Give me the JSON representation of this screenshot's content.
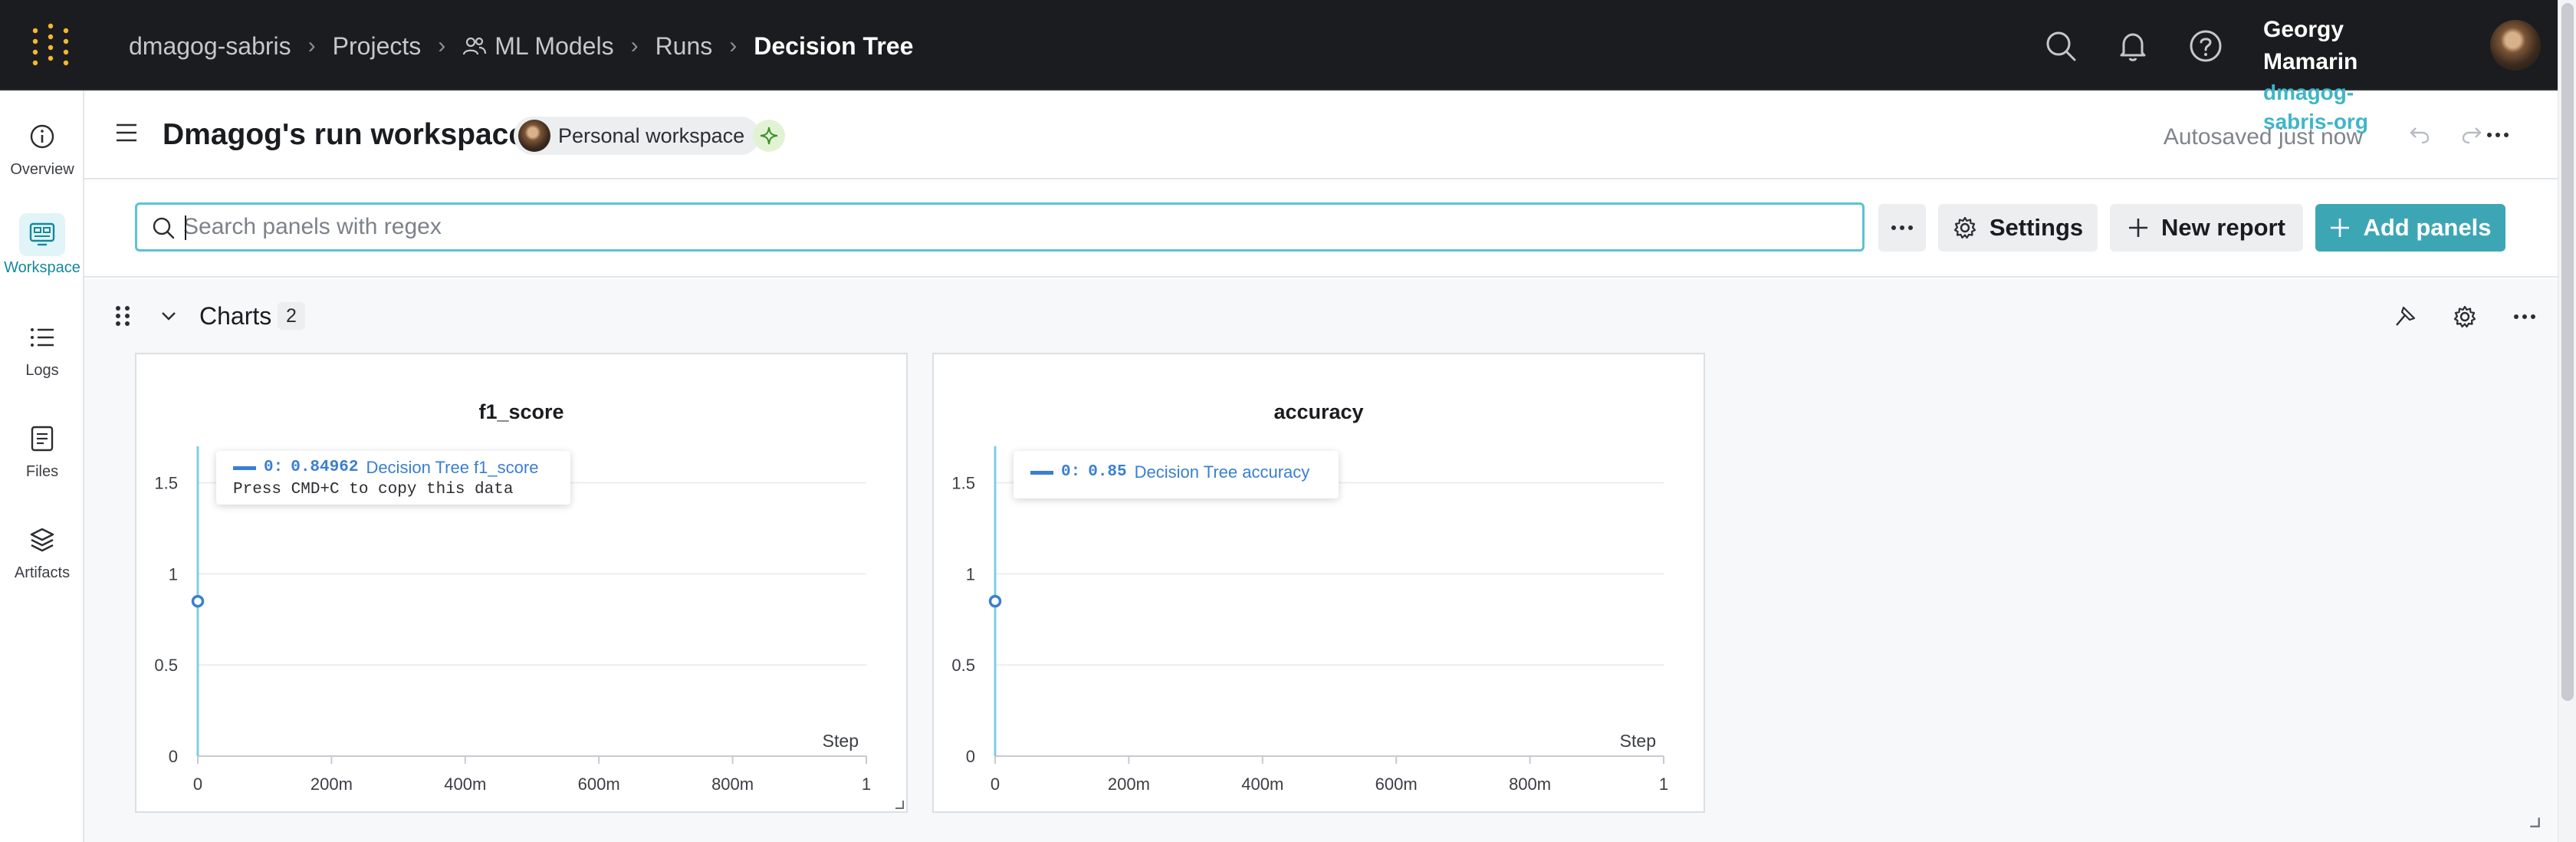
{
  "topbar": {
    "breadcrumbs": [
      {
        "label": "dmagog-sabris",
        "icon": null
      },
      {
        "label": "Projects",
        "icon": null
      },
      {
        "label": "ML Models",
        "icon": "users-icon"
      },
      {
        "label": "Runs",
        "icon": null
      },
      {
        "label": "Decision Tree",
        "icon": null
      }
    ],
    "user": {
      "name": "Georgy Mamarin",
      "org": "dmagog-sabris-org"
    }
  },
  "sidebar": {
    "items": [
      {
        "label": "Overview",
        "icon": "info-icon",
        "active": false
      },
      {
        "label": "Workspace",
        "icon": "workspace-icon",
        "active": true
      },
      {
        "label": "Logs",
        "icon": "list-icon",
        "active": false
      },
      {
        "label": "Files",
        "icon": "file-icon",
        "active": false
      },
      {
        "label": "Artifacts",
        "icon": "layers-icon",
        "active": false
      }
    ]
  },
  "workspace": {
    "title": "Dmagog's run workspace",
    "badge": "Personal workspace",
    "autosaved": "Autosaved just now"
  },
  "toolbar": {
    "search_placeholder": "Search panels with regex",
    "settings_label": "Settings",
    "new_report_label": "New report",
    "add_panels_label": "Add panels"
  },
  "section": {
    "title": "Charts",
    "count": "2"
  },
  "panels": [
    {
      "title": "f1_score",
      "tooltip": {
        "index": "0:",
        "value": "0.84962",
        "series": "Decision Tree f1_score",
        "hint": "Press CMD+C to copy this data"
      }
    },
    {
      "title": "accuracy",
      "tooltip": {
        "index": "0:",
        "value": "0.85",
        "series": "Decision Tree accuracy",
        "hint": ""
      }
    }
  ],
  "colors": {
    "accent": "#3da6b5",
    "series": "#3a7fcf",
    "topbar": "#1a1c1f"
  },
  "chart_data": [
    {
      "type": "line",
      "title": "f1_score",
      "xlabel": "Step",
      "ylabel": "",
      "x_ticks": [
        "0",
        "200m",
        "400m",
        "600m",
        "800m",
        "1"
      ],
      "y_ticks": [
        "0",
        "0.5",
        "1",
        "1.5"
      ],
      "xlim": [
        0,
        1
      ],
      "ylim": [
        0,
        1.7
      ],
      "series": [
        {
          "name": "Decision Tree f1_score",
          "x": [
            0
          ],
          "y": [
            0.84962
          ]
        }
      ]
    },
    {
      "type": "line",
      "title": "accuracy",
      "xlabel": "Step",
      "ylabel": "",
      "x_ticks": [
        "0",
        "200m",
        "400m",
        "600m",
        "800m",
        "1"
      ],
      "y_ticks": [
        "0",
        "0.5",
        "1",
        "1.5"
      ],
      "xlim": [
        0,
        1
      ],
      "ylim": [
        0,
        1.7
      ],
      "series": [
        {
          "name": "Decision Tree accuracy",
          "x": [
            0
          ],
          "y": [
            0.85
          ]
        }
      ]
    }
  ]
}
